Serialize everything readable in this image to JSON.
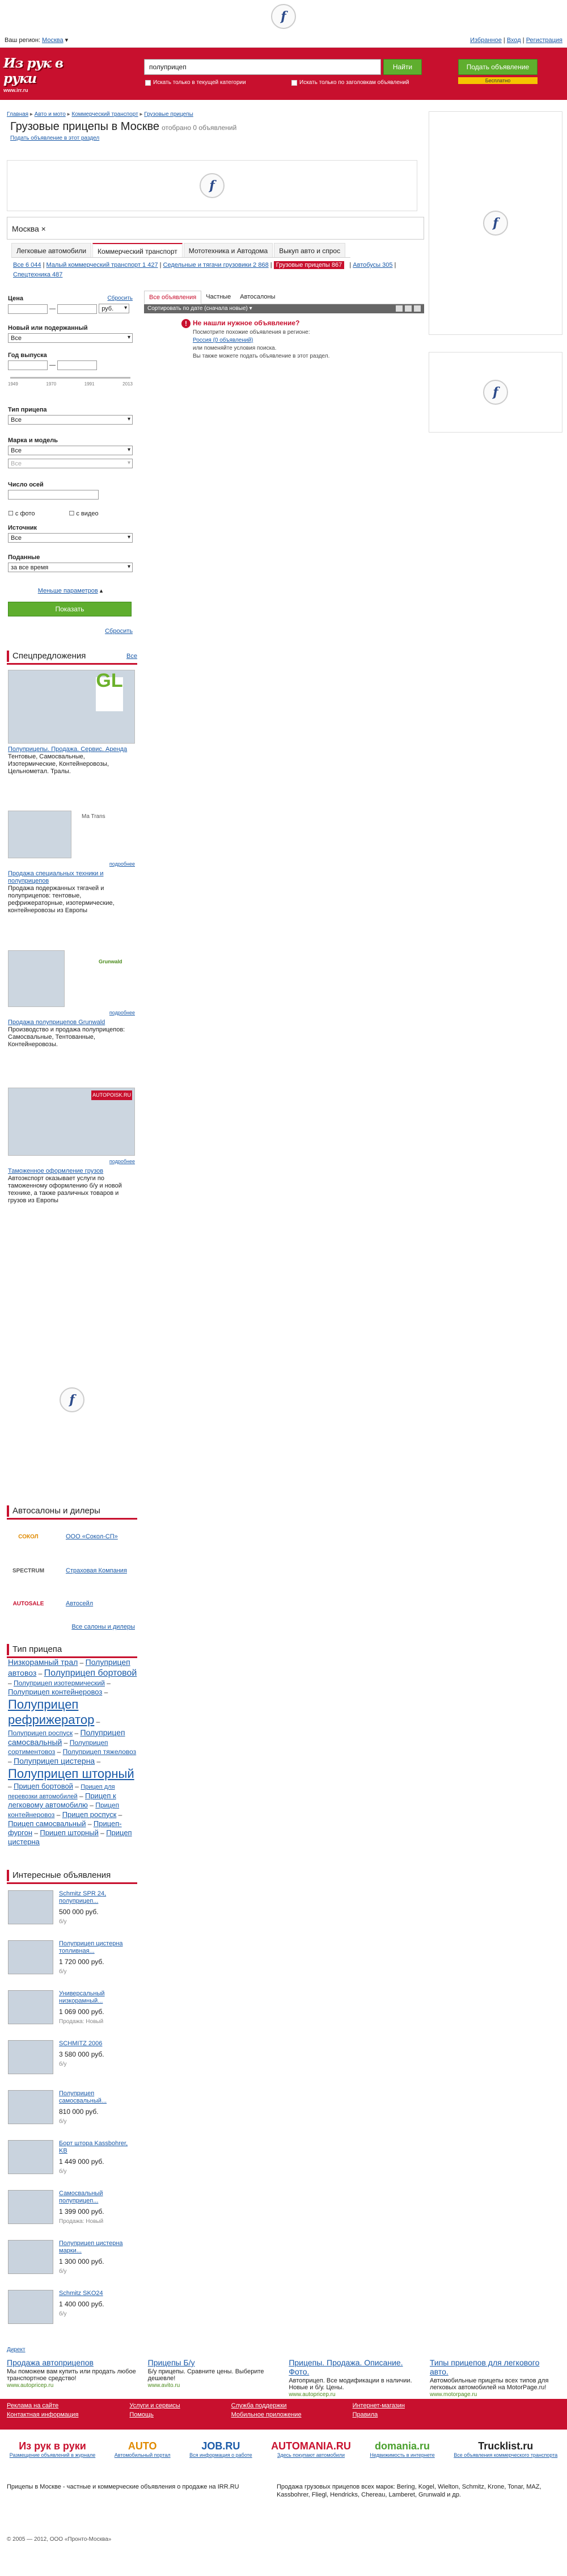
{
  "region": {
    "label": "Ваш регион:",
    "value": "Москва"
  },
  "user_links": [
    "Избранное",
    "Вход",
    "Регистрация"
  ],
  "logo": {
    "name": "Из рук в руки",
    "sub": "www.irr.ru"
  },
  "search": {
    "value": "полуприцеп",
    "button": "Найти",
    "check1": "Искать только в текущей категории",
    "check2": "Искать только по заголовкам объявлений"
  },
  "add": {
    "button": "Подать объявление",
    "sub": "Бесплатно"
  },
  "breadcrumbs": [
    "Главная",
    "Авто и мото",
    "Коммерческий транспорт",
    "Грузовые прицепы"
  ],
  "page": {
    "title": "Грузовые прицепы в Москве",
    "count": "отобрано 0 объявлений",
    "add_link": "Подать объявление в этот раздел"
  },
  "location": {
    "value": "Москва"
  },
  "cat_tabs": [
    "Легковые автомобили",
    "Коммерческий транспорт",
    "Мототехника и Автодома",
    "Выкуп авто и спрос"
  ],
  "subcats": [
    "Все 6 044",
    "Малый коммерческий транспорт 1 427",
    "Седельные и тягачи грузовики 2 868",
    "Грузовые прицепы 867",
    "Автобусы 305",
    "Спецтехника 487"
  ],
  "filters": {
    "price": {
      "label": "Цена",
      "currency": "руб.",
      "reset": "Сбросить"
    },
    "new_used": {
      "label": "Новый или подержанный",
      "value": "Все"
    },
    "year": {
      "label": "Год выпуска",
      "ticks": [
        "1949",
        "1970",
        "1991",
        "2013"
      ]
    },
    "type": {
      "label": "Тип прицепа",
      "value": "Все"
    },
    "make": {
      "label": "Марка и модель",
      "value": "Все",
      "model": "Все"
    },
    "axles": {
      "label": "Число осей"
    },
    "photo": "с фото",
    "video": "с видео",
    "source": {
      "label": "Источник",
      "value": "Все"
    },
    "submitted": {
      "label": "Поданные",
      "value": "за все время"
    },
    "less": "Меньше параметров",
    "show": "Показать",
    "reset2": "Сбросить"
  },
  "results": {
    "tabs": [
      "Все объявления",
      "Частные",
      "Автосалоны"
    ],
    "sort": "Сортировать по дате (сначала новые)",
    "notfound_title": "Не нашли нужное объявление?",
    "notfound_lines": [
      "Посмотрите похожие объявления в регионе:",
      "Россия (0 объявлений)",
      "или поменяйте условия поиска.",
      "Вы также можете подать объявление в этот раздел."
    ]
  },
  "special": {
    "title": "Спецпредложения",
    "all": "Все",
    "items": [
      {
        "title": "Полуприцепы. Продажа. Сервис. Аренда",
        "text": "Тентовые, Самосвальные, Изотермические, Контейнеровозы, Цельнометал. Тралы.",
        "logo": "GL"
      },
      {
        "title": "Продажа специальных техники и полуприцепов",
        "text": "Продажа подержанных тягачей и полуприцепов: тентовые, рефрижераторные, изотермические, контейнеровозы из Европы",
        "logo": "Ma Trans",
        "more": "подробнее"
      },
      {
        "title": "Продажа полуприцепов Grunwald",
        "text": "Производство и продажа полуприцепов: Самосвальные, Тентованные, Контейнеровозы.",
        "logo": "Grunwald",
        "more": "подробнее"
      },
      {
        "title": "Таможенное оформление грузов",
        "text": "Автоэкспорт оказывает услуги по таможенному оформлению б/у и новой технике, а также различных товаров и грузов из Европы",
        "logo": "AUTOPOISK.RU",
        "more": "подробнее"
      }
    ]
  },
  "dealers": {
    "title": "Автосалоны и дилеры",
    "items": [
      {
        "logo": "СОКОЛ",
        "name": "ООО «Сокол-СП»"
      },
      {
        "logo": "SPECTRUM",
        "name": "Страховая Компания"
      },
      {
        "logo": "AUTOSALE",
        "name": "Автосейл"
      }
    ],
    "all": "Все салоны и дилеры"
  },
  "trailer_types": {
    "title": "Тип прицепа",
    "items": [
      {
        "t": "Низкорамный трал",
        "s": 14
      },
      {
        "t": "Полуприцеп автовоз",
        "s": 14
      },
      {
        "t": "Полуприцеп бортовой",
        "s": 16
      },
      {
        "t": "Полуприцеп изотермический",
        "s": 12
      },
      {
        "t": "Полуприцеп контейнеровоз",
        "s": 13
      },
      {
        "t": "Полуприцеп рефрижератор",
        "s": 22
      },
      {
        "t": "Полуприцеп роспуск",
        "s": 12
      },
      {
        "t": "Полуприцеп самосвальный",
        "s": 14
      },
      {
        "t": "Полуприцеп сортиментовоз",
        "s": 12
      },
      {
        "t": "Полуприцеп тяжеловоз",
        "s": 12
      },
      {
        "t": "Полуприцеп цистерна",
        "s": 14
      },
      {
        "t": "Полуприцеп шторный",
        "s": 22
      },
      {
        "t": "Прицеп бортовой",
        "s": 13
      },
      {
        "t": "Прицеп для перевозки автомобилей",
        "s": 11
      },
      {
        "t": "Прицеп к легковому автомобилю",
        "s": 13
      },
      {
        "t": "Прицеп контейнеровоз",
        "s": 12
      },
      {
        "t": "Прицеп роспуск",
        "s": 13
      },
      {
        "t": "Прицеп самосвальный",
        "s": 13
      },
      {
        "t": "Прицеп-фургон",
        "s": 13
      },
      {
        "t": "Прицеп шторный",
        "s": 13
      },
      {
        "t": "Прицеп цистерна",
        "s": 13
      }
    ]
  },
  "interesting": {
    "title": "Интересные объявления",
    "items": [
      {
        "name": "Schmitz SPR 24, полуприцеп...",
        "price": "500 000 руб.",
        "city": "б/у"
      },
      {
        "name": "Полуприцеп цистерна топливная...",
        "price": "1 720 000 руб.",
        "city": "б/у"
      },
      {
        "name": "Универсальный низкорамный...",
        "price": "1 069 000 руб.",
        "city": "Продажа: Новый"
      },
      {
        "name": "SCHMITZ 2006",
        "price": "3 580 000 руб.",
        "city": "б/у"
      },
      {
        "name": "Полуприцеп самосвальный...",
        "price": "810 000 руб.",
        "city": "б/у"
      },
      {
        "name": "Борт штора Kassbohrer, KB",
        "price": "1 449 000 руб.",
        "city": "б/у"
      },
      {
        "name": "Самосвальный полуприцеп...",
        "price": "1 399 000 руб.",
        "city": "Продажа: Новый"
      },
      {
        "name": "Полуприцеп цистерна марки...",
        "price": "1 300 000 руб.",
        "city": "б/у"
      },
      {
        "name": "Schmitz SKO24",
        "price": "1 400 000 руб.",
        "city": "б/у"
      }
    ]
  },
  "direct": "Директ",
  "footer_ads": [
    {
      "t": "Продажа автоприцепов",
      "d": "Мы поможем вам купить или продать любое транспортное средство!",
      "u": "www.autopricep.ru"
    },
    {
      "t": "Прицепы Б/у",
      "d": "Б/у прицепы. Сравните цены. Выберите дешевле!",
      "u": "www.avito.ru"
    },
    {
      "t": "Прицепы. Продажа. Описание. Фото.",
      "d": "Автоприцеп. Все модификации в наличии. Новые и б/у. Цены.",
      "u": "www.autopricep.ru"
    },
    {
      "t": "Типы прицепов для легкового авто.",
      "d": "Автомобильные прицепы всех типов для легковых автомобилей на MotorPage.ru!",
      "u": "www.motorpage.ru"
    }
  ],
  "footer_nav": [
    [
      "Реклама на сайте",
      "Контактная информация"
    ],
    [
      "Услуги и сервисы",
      "Помощь"
    ],
    [
      "Служба поддержки",
      "Мобильное приложение"
    ],
    [
      "Интернет-магазин",
      "Правила"
    ]
  ],
  "partners": [
    {
      "n": "Из рук в руки",
      "s": "Размещение объявлений в журнале"
    },
    {
      "n": "AUTO",
      "s": "Автомобильный портал"
    },
    {
      "n": "JOB.RU",
      "s": "Вся информация о работе"
    },
    {
      "n": "AUTOMANIA.RU",
      "s": "Здесь покупают автомобили"
    },
    {
      "n": "domania.ru",
      "s": "Недвижимость в интернете"
    },
    {
      "n": "Trucklist.ru",
      "s": "Все объявления коммерческого транспорта"
    }
  ],
  "bottom": {
    "left": "Прицепы в Москве - частные и коммерческие объявления о продаже на IRR.RU",
    "right": "Продажа грузовых прицепов всех марок: Bering, Kogel, Wielton, Schmitz, Krone, Tonar, MAZ, Kassbohrer, Fliegl, Hendricks, Chereau, Lamberet, Grunwald и др."
  },
  "copyright": "© 2005 — 2012, ООО «Пронто-Москва»"
}
